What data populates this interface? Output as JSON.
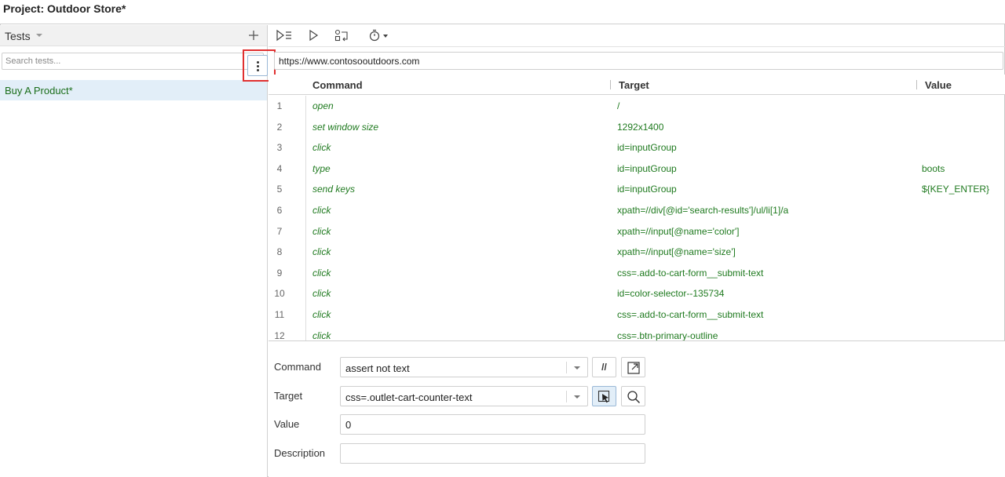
{
  "project": {
    "title": "Project:  Outdoor Store*"
  },
  "sidebar": {
    "header": {
      "label": "Tests",
      "add_icon": "plus-icon",
      "dropdown_icon": "caret-down-icon"
    },
    "search": {
      "placeholder": "Search tests...",
      "icon": "search-icon"
    },
    "tests": [
      {
        "label": "Buy A Product*",
        "selected": true,
        "menu_icon": "kebab-vertical-icon"
      }
    ],
    "highlight_color": "#e03030",
    "selected_color": "#e2eef8"
  },
  "toolbar": {
    "buttons": [
      {
        "name": "run-all-tests-button",
        "icon": "run-all-icon"
      },
      {
        "name": "run-current-test-button",
        "icon": "play-icon"
      },
      {
        "name": "record-button",
        "icon": "step-record-icon"
      },
      {
        "name": "speed-button",
        "icon": "stopwatch-icon"
      }
    ]
  },
  "url": {
    "value": "https://www.contosooutdoors.com"
  },
  "table": {
    "columns": {
      "command": "Command",
      "target": "Target",
      "value": "Value"
    },
    "rows": [
      {
        "num": "1",
        "command": "open",
        "target": "/",
        "value": ""
      },
      {
        "num": "2",
        "command": "set window size",
        "target": "1292x1400",
        "value": ""
      },
      {
        "num": "3",
        "command": "click",
        "target": "id=inputGroup",
        "value": ""
      },
      {
        "num": "4",
        "command": "type",
        "target": "id=inputGroup",
        "value": "boots"
      },
      {
        "num": "5",
        "command": "send keys",
        "target": "id=inputGroup",
        "value": "${KEY_ENTER}"
      },
      {
        "num": "6",
        "command": "click",
        "target": "xpath=//div[@id='search-results']/ul/li[1]/a",
        "value": ""
      },
      {
        "num": "7",
        "command": "click",
        "target": "xpath=//input[@name='color']",
        "value": ""
      },
      {
        "num": "8",
        "command": "click",
        "target": "xpath=//input[@name='size']",
        "value": ""
      },
      {
        "num": "9",
        "command": "click",
        "target": "css=.add-to-cart-form__submit-text",
        "value": ""
      },
      {
        "num": "10",
        "command": "click",
        "target": "id=color-selector--135734",
        "value": ""
      },
      {
        "num": "11",
        "command": "click",
        "target": "css=.add-to-cart-form__submit-text",
        "value": ""
      },
      {
        "num": "12",
        "command": "click",
        "target": "css=.btn-primary-outline",
        "value": ""
      }
    ],
    "text_color": "#1f7a1f"
  },
  "editor": {
    "command": {
      "label": "Command",
      "value": "assert not text",
      "comment_glyph": "//"
    },
    "target": {
      "label": "Target",
      "value": "css=.outlet-cart-counter-text"
    },
    "value": {
      "label": "Value",
      "value": "0"
    },
    "description": {
      "label": "Description",
      "value": ""
    }
  }
}
